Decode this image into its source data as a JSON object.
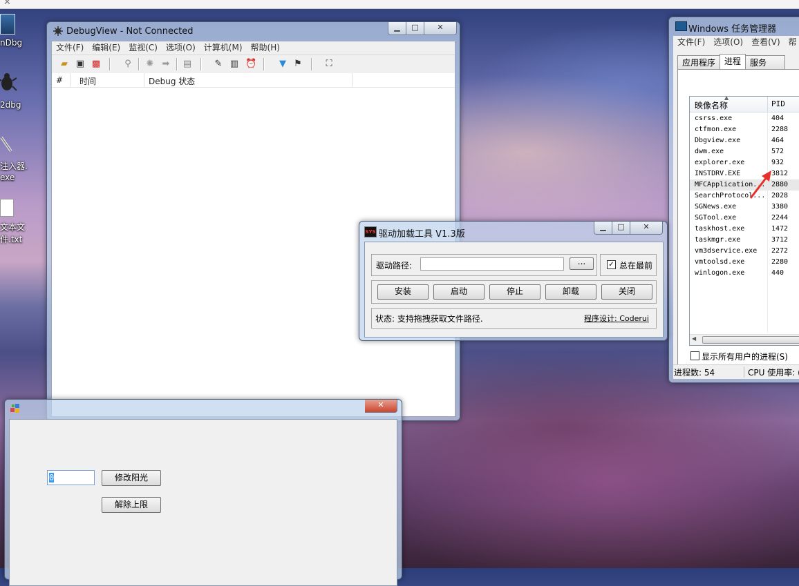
{
  "desktop": {
    "icons": [
      {
        "label": "nDbg"
      },
      {
        "label": "2dbg"
      },
      {
        "label": "注入器.",
        "label2": "exe"
      },
      {
        "label": "文本文",
        "label2": "件.txt"
      }
    ]
  },
  "debugview": {
    "title": "DebugView - Not Connected",
    "menu": [
      "文件(F)",
      "编辑(E)",
      "监视(C)",
      "选项(O)",
      "计算机(M)",
      "帮助(H)"
    ],
    "columns": [
      "#",
      "时间",
      "Debug 状态"
    ],
    "toolbar_icons": [
      "open-icon",
      "save-icon",
      "clear-icon",
      "search-icon",
      "capture-icon",
      "arrow-right-icon",
      "scroll-icon",
      "edit-filter-icon",
      "highlight-icon",
      "clock-icon",
      "filter-icon",
      "highlight-filter-icon",
      "binoculars-icon"
    ]
  },
  "driver_tool": {
    "title": "驱动加载工具 V1.3版",
    "app_badge": "SYS",
    "path_label": "驱动路径:",
    "path_value": "",
    "browse_label": "...",
    "always_on_top_label": "总在最前",
    "always_on_top_checked": true,
    "buttons": [
      "安装",
      "启动",
      "停止",
      "卸载",
      "关闭"
    ],
    "status_text": "状态: 支持拖拽获取文件路径.",
    "credit_text": "程序设计: Coderui"
  },
  "task_manager": {
    "title": "Windows 任务管理器",
    "menu": [
      "文件(F)",
      "选项(O)",
      "查看(V)",
      "帮"
    ],
    "tabs": [
      "应用程序",
      "进程",
      "服务"
    ],
    "active_tab": "进程",
    "columns": [
      "映像名称",
      "PID"
    ],
    "processes": [
      {
        "name": "csrss.exe",
        "pid": "404"
      },
      {
        "name": "ctfmon.exe",
        "pid": "2288"
      },
      {
        "name": "Dbgview.exe",
        "pid": "464"
      },
      {
        "name": "dwm.exe",
        "pid": "572"
      },
      {
        "name": "explorer.exe",
        "pid": "932"
      },
      {
        "name": "INSTDRV.EXE",
        "pid": "3812"
      },
      {
        "name": "MFCApplication...",
        "pid": "2880"
      },
      {
        "name": "SearchProtocol...",
        "pid": "2028"
      },
      {
        "name": "SGNews.exe",
        "pid": "3380"
      },
      {
        "name": "SGTool.exe",
        "pid": "2244"
      },
      {
        "name": "taskhost.exe",
        "pid": "1472"
      },
      {
        "name": "taskmgr.exe",
        "pid": "3712"
      },
      {
        "name": "vm3dservice.exe",
        "pid": "2272"
      },
      {
        "name": "vmtoolsd.exe",
        "pid": "2280"
      },
      {
        "name": "winlogon.exe",
        "pid": "440"
      }
    ],
    "selected_process": "MFCApplication...",
    "show_all_users_label": "显示所有用户的进程(S)",
    "status_process_count": "进程数: 54",
    "status_cpu": "CPU 使用率: ("
  },
  "mfc_app": {
    "input_value": "0",
    "modify_button": "修改阳光",
    "unlimit_button": "解除上限"
  },
  "annotation": {
    "color": "#e8302a"
  }
}
